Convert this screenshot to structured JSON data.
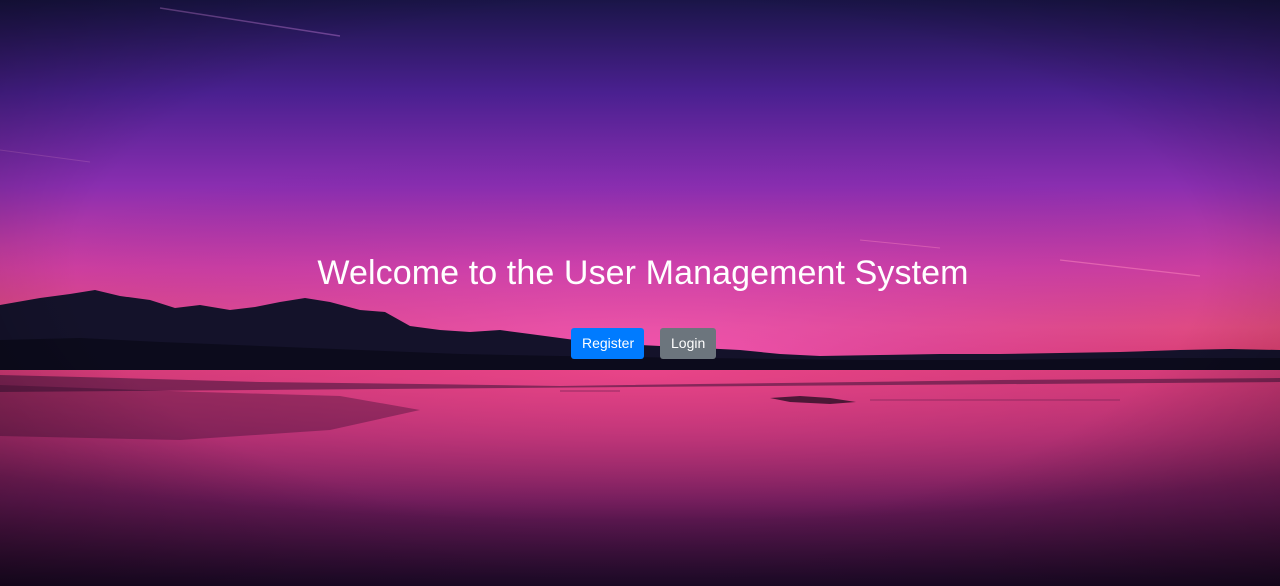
{
  "hero": {
    "title": "Welcome to the User Management System",
    "background": "sunset-lake-mountains-photo"
  },
  "actions": {
    "register_label": "Register",
    "login_label": "Login"
  },
  "colors": {
    "register_button": "#007bff",
    "login_button": "#6c757d",
    "title_text": "#ffffff",
    "sky_top": "#1c1650",
    "sky_glow": "#f04fb2",
    "water": "#a02866"
  }
}
